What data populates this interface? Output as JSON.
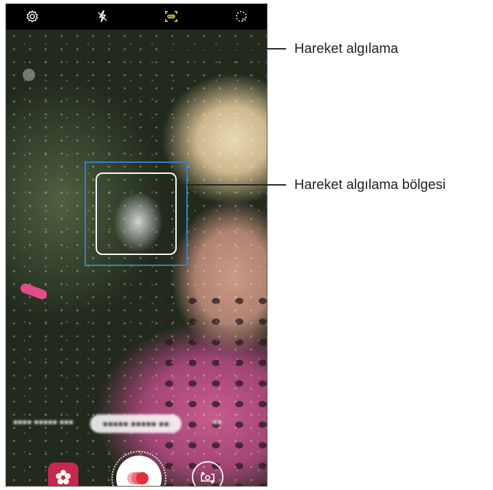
{
  "callouts": {
    "motion_detection": "Hareket algılama",
    "motion_detection_area": "Hareket algılama bölgesi"
  },
  "camera": {
    "top_bar_icons": [
      "settings-icon",
      "flash-off-icon",
      "motion-detection-icon",
      "auto-record-icon"
    ],
    "accent_color": "#e8d94a",
    "detection_frame_color": "#2f84d6",
    "shutter_color": "#e03040",
    "bixby_color": "#c52a4a"
  }
}
